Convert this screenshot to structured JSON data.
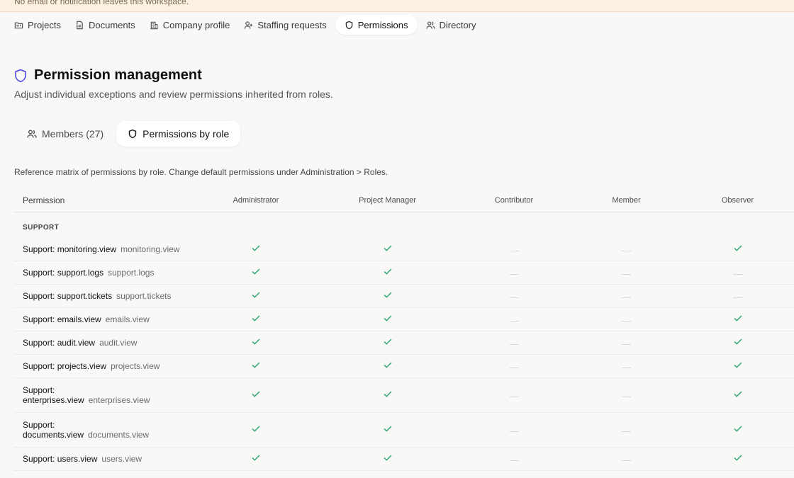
{
  "banner": {
    "text": "No email or notification leaves this workspace."
  },
  "nav": [
    {
      "label": "Projects",
      "icon": "folder-icon",
      "active": false
    },
    {
      "label": "Documents",
      "icon": "document-icon",
      "active": false
    },
    {
      "label": "Company profile",
      "icon": "building-icon",
      "active": false
    },
    {
      "label": "Staffing requests",
      "icon": "user-plus-icon",
      "active": false
    },
    {
      "label": "Permissions",
      "icon": "shield-icon",
      "active": true
    },
    {
      "label": "Directory",
      "icon": "users-icon",
      "active": false
    }
  ],
  "page": {
    "title": "Permission management",
    "subtitle": "Adjust individual exceptions and review permissions inherited from roles."
  },
  "tabs": [
    {
      "label": "Members (27)",
      "icon": "users-icon",
      "active": false
    },
    {
      "label": "Permissions by role",
      "icon": "shield-icon",
      "active": true
    }
  ],
  "note": "Reference matrix of permissions by role. Change default permissions under Administration > Roles.",
  "matrix": {
    "headers": [
      "Permission",
      "Administrator",
      "Project Manager",
      "Contributor",
      "Member",
      "Observer"
    ],
    "group": "SUPPORT",
    "rows": [
      {
        "name": "Support: monitoring.view",
        "key": "monitoring.view",
        "values": [
          true,
          true,
          false,
          false,
          true
        ]
      },
      {
        "name": "Support: support.logs",
        "key": "support.logs",
        "values": [
          true,
          true,
          false,
          false,
          false
        ]
      },
      {
        "name": "Support: support.tickets",
        "key": "support.tickets",
        "values": [
          true,
          true,
          false,
          false,
          false
        ]
      },
      {
        "name": "Support: emails.view",
        "key": "emails.view",
        "values": [
          true,
          true,
          false,
          false,
          true
        ]
      },
      {
        "name": "Support: audit.view",
        "key": "audit.view",
        "values": [
          true,
          true,
          false,
          false,
          true
        ]
      },
      {
        "name": "Support: projects.view",
        "key": "projects.view",
        "values": [
          true,
          true,
          false,
          false,
          true
        ]
      },
      {
        "name_line1": "Support:",
        "name": "enterprises.view",
        "key": "enterprises.view",
        "values": [
          true,
          true,
          false,
          false,
          true
        ],
        "wrap": true
      },
      {
        "name_line1": "Support:",
        "name": "documents.view",
        "key": "documents.view",
        "values": [
          true,
          true,
          false,
          false,
          true
        ],
        "wrap": true
      },
      {
        "name": "Support: users.view",
        "key": "users.view",
        "values": [
          true,
          true,
          false,
          false,
          true
        ]
      }
    ]
  },
  "colors": {
    "accent": "#4f46e5",
    "check": "#22a06b",
    "banner": "#fcf1e1"
  }
}
